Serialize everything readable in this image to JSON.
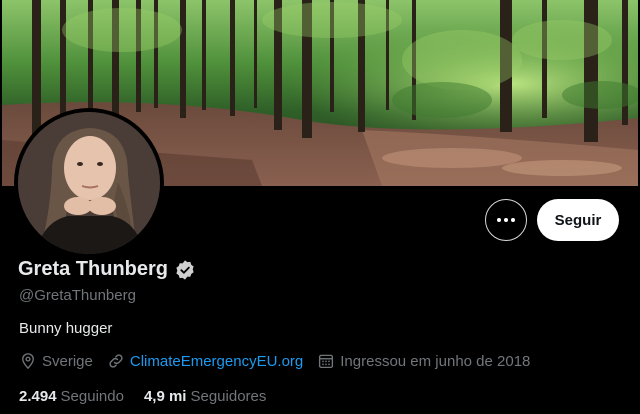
{
  "profile": {
    "display_name": "Greta Thunberg",
    "handle": "@GretaThunberg",
    "bio": "Bunny hugger",
    "verified": true,
    "location": "Sverige",
    "website": "ClimateEmergencyEU.org",
    "joined": "Ingressou em junho de 2018"
  },
  "stats": {
    "following_count": "2.494",
    "following_label": "Seguindo",
    "followers_count": "4,9 mi",
    "followers_label": "Seguidores"
  },
  "actions": {
    "follow_label": "Seguir",
    "more_icon": "more-horizontal-icon"
  },
  "colors": {
    "background": "#000000",
    "text_primary": "#e7e9ea",
    "text_secondary": "#71767b",
    "link": "#1d9bf0",
    "follow_bg": "#ffffff"
  },
  "icons": {
    "location": "location-pin-icon",
    "website": "link-icon",
    "joined": "calendar-icon",
    "verified": "verified-badge-icon"
  }
}
